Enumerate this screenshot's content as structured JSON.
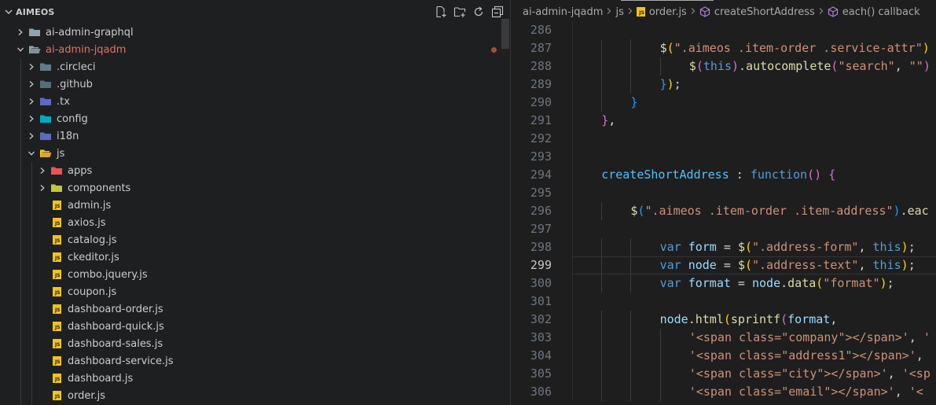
{
  "explorer": {
    "title": "AIMEOS",
    "actions": [
      "new-file-icon",
      "new-folder-icon",
      "refresh-icon",
      "collapse-all-icon"
    ],
    "items": [
      {
        "label": "ai-admin-graphql",
        "depth": 0,
        "type": "folder",
        "expanded": false,
        "icon": "folder-icon",
        "color": "#90a4ae"
      },
      {
        "label": "ai-admin-jqadm",
        "depth": 0,
        "type": "folder",
        "expanded": true,
        "icon": "folder-open-icon",
        "color": "#90a4ae",
        "modified": true
      },
      {
        "label": ".circleci",
        "depth": 1,
        "type": "folder",
        "expanded": false,
        "icon": "folder-circleci-icon",
        "color": "#607d8b"
      },
      {
        "label": ".github",
        "depth": 1,
        "type": "folder",
        "expanded": false,
        "icon": "folder-github-icon",
        "color": "#546e7a"
      },
      {
        "label": ".tx",
        "depth": 1,
        "type": "folder",
        "expanded": false,
        "icon": "folder-i18n-icon",
        "color": "#5c6bc0"
      },
      {
        "label": "config",
        "depth": 1,
        "type": "folder",
        "expanded": false,
        "icon": "folder-config-icon",
        "color": "#00acc1"
      },
      {
        "label": "i18n",
        "depth": 1,
        "type": "folder",
        "expanded": false,
        "icon": "folder-i18n-icon",
        "color": "#5c6bc0"
      },
      {
        "label": "js",
        "depth": 1,
        "type": "folder",
        "expanded": true,
        "icon": "folder-js-open-icon",
        "color": "#fbc02d"
      },
      {
        "label": "apps",
        "depth": 2,
        "type": "folder",
        "expanded": false,
        "icon": "folder-apps-icon",
        "color": "#ef5350"
      },
      {
        "label": "components",
        "depth": 2,
        "type": "folder",
        "expanded": false,
        "icon": "folder-components-icon",
        "color": "#c0ca33"
      },
      {
        "label": "admin.js",
        "depth": 2,
        "type": "file",
        "icon": "js-file-icon"
      },
      {
        "label": "axios.js",
        "depth": 2,
        "type": "file",
        "icon": "js-file-icon"
      },
      {
        "label": "catalog.js",
        "depth": 2,
        "type": "file",
        "icon": "js-file-icon"
      },
      {
        "label": "ckeditor.js",
        "depth": 2,
        "type": "file",
        "icon": "js-file-icon"
      },
      {
        "label": "combo.jquery.js",
        "depth": 2,
        "type": "file",
        "icon": "js-file-icon"
      },
      {
        "label": "coupon.js",
        "depth": 2,
        "type": "file",
        "icon": "js-file-icon"
      },
      {
        "label": "dashboard-order.js",
        "depth": 2,
        "type": "file",
        "icon": "js-file-icon"
      },
      {
        "label": "dashboard-quick.js",
        "depth": 2,
        "type": "file",
        "icon": "js-file-icon"
      },
      {
        "label": "dashboard-sales.js",
        "depth": 2,
        "type": "file",
        "icon": "js-file-icon"
      },
      {
        "label": "dashboard-service.js",
        "depth": 2,
        "type": "file",
        "icon": "js-file-icon"
      },
      {
        "label": "dashboard.js",
        "depth": 2,
        "type": "file",
        "icon": "js-file-icon"
      },
      {
        "label": "order.js",
        "depth": 2,
        "type": "file",
        "icon": "js-file-icon"
      }
    ]
  },
  "breadcrumb": [
    {
      "label": "ai-admin-jqadm",
      "icon": ""
    },
    {
      "label": "js",
      "icon": ""
    },
    {
      "label": "order.js",
      "icon": "js-file-icon"
    },
    {
      "label": "createShortAddress",
      "icon": "method-icon"
    },
    {
      "label": "each() callback",
      "icon": "method-icon"
    }
  ],
  "editor": {
    "current_line": "299",
    "lines": [
      {
        "n": "286",
        "indent": 0,
        "tokens": []
      },
      {
        "n": "287",
        "indent": 3,
        "tokens": [
          [
            "t-fn",
            "$"
          ],
          [
            "t-p1",
            "("
          ],
          [
            "t-str",
            "\".aimeos .item-order .service-attr\""
          ],
          [
            "t-p1",
            ")"
          ]
        ]
      },
      {
        "n": "288",
        "indent": 4,
        "tokens": [
          [
            "t-fn",
            "$"
          ],
          [
            "t-p2",
            "("
          ],
          [
            "t-kw",
            "this"
          ],
          [
            "t-p2",
            ")"
          ],
          [
            "t-def",
            "."
          ],
          [
            "t-fn",
            "autocomplete"
          ],
          [
            "t-p2",
            "("
          ],
          [
            "t-str",
            "\"search\""
          ],
          [
            "t-def",
            ", "
          ],
          [
            "t-str",
            "\"\""
          ],
          [
            "t-p2",
            ")"
          ]
        ]
      },
      {
        "n": "289",
        "indent": 3,
        "tokens": [
          [
            "t-p3",
            "}"
          ],
          [
            "t-p1",
            ")"
          ],
          [
            "t-def",
            ";"
          ]
        ]
      },
      {
        "n": "290",
        "indent": 2,
        "tokens": [
          [
            "t-p3",
            "}"
          ]
        ]
      },
      {
        "n": "291",
        "indent": 1,
        "tokens": [
          [
            "t-p2",
            "}"
          ],
          [
            "t-def",
            ","
          ]
        ]
      },
      {
        "n": "292",
        "indent": 0,
        "tokens": []
      },
      {
        "n": "293",
        "indent": 0,
        "tokens": []
      },
      {
        "n": "294",
        "indent": 1,
        "tokens": [
          [
            "t-prop",
            "createShortAddress"
          ],
          [
            "t-def",
            " : "
          ],
          [
            "t-kw",
            "function"
          ],
          [
            "t-p2",
            "()"
          ],
          [
            "t-def",
            " "
          ],
          [
            "t-p2",
            "{"
          ]
        ]
      },
      {
        "n": "295",
        "indent": 0,
        "tokens": []
      },
      {
        "n": "296",
        "indent": 2,
        "tokens": [
          [
            "t-fn",
            "$"
          ],
          [
            "t-p3",
            "("
          ],
          [
            "t-str",
            "\".aimeos .item-order .item-address\""
          ],
          [
            "t-p3",
            ")"
          ],
          [
            "t-def",
            "."
          ],
          [
            "t-fn",
            "eac"
          ]
        ]
      },
      {
        "n": "297",
        "indent": 0,
        "tokens": []
      },
      {
        "n": "298",
        "indent": 3,
        "tokens": [
          [
            "t-kw",
            "var"
          ],
          [
            "t-def",
            " "
          ],
          [
            "t-var",
            "form"
          ],
          [
            "t-def",
            " = "
          ],
          [
            "t-fn",
            "$"
          ],
          [
            "t-p1",
            "("
          ],
          [
            "t-str",
            "\".address-form\""
          ],
          [
            "t-def",
            ", "
          ],
          [
            "t-kw",
            "this"
          ],
          [
            "t-p1",
            ")"
          ],
          [
            "t-def",
            ";"
          ]
        ]
      },
      {
        "n": "299",
        "indent": 3,
        "tokens": [
          [
            "t-kw",
            "var"
          ],
          [
            "t-def",
            " "
          ],
          [
            "t-var",
            "node"
          ],
          [
            "t-def",
            " = "
          ],
          [
            "t-fn",
            "$"
          ],
          [
            "t-p1",
            "("
          ],
          [
            "t-str",
            "\".address-text\""
          ],
          [
            "t-def",
            ", "
          ],
          [
            "t-kw",
            "this"
          ],
          [
            "t-p1",
            ")"
          ],
          [
            "t-def",
            ";"
          ]
        ]
      },
      {
        "n": "300",
        "indent": 3,
        "tokens": [
          [
            "t-kw",
            "var"
          ],
          [
            "t-def",
            " "
          ],
          [
            "t-var",
            "format"
          ],
          [
            "t-def",
            " = "
          ],
          [
            "t-var",
            "node"
          ],
          [
            "t-def",
            "."
          ],
          [
            "t-fn",
            "data"
          ],
          [
            "t-p1",
            "("
          ],
          [
            "t-str",
            "\"format\""
          ],
          [
            "t-p1",
            ")"
          ],
          [
            "t-def",
            ";"
          ]
        ]
      },
      {
        "n": "301",
        "indent": 0,
        "tokens": []
      },
      {
        "n": "302",
        "indent": 3,
        "tokens": [
          [
            "t-var",
            "node"
          ],
          [
            "t-def",
            "."
          ],
          [
            "t-fn",
            "html"
          ],
          [
            "t-p1",
            "("
          ],
          [
            "t-fn",
            "sprintf"
          ],
          [
            "t-p2",
            "("
          ],
          [
            "t-var",
            "format"
          ],
          [
            "t-def",
            ","
          ]
        ]
      },
      {
        "n": "303",
        "indent": 4,
        "tokens": [
          [
            "t-str",
            "'<span class=\"company\"></span>'"
          ],
          [
            "t-def",
            ", "
          ],
          [
            "t-str",
            "'"
          ]
        ]
      },
      {
        "n": "304",
        "indent": 4,
        "tokens": [
          [
            "t-str",
            "'<span class=\"address1\"></span>'"
          ],
          [
            "t-def",
            ","
          ]
        ]
      },
      {
        "n": "305",
        "indent": 4,
        "tokens": [
          [
            "t-str",
            "'<span class=\"city\"></span>'"
          ],
          [
            "t-def",
            ", "
          ],
          [
            "t-str",
            "'<sp"
          ]
        ]
      },
      {
        "n": "306",
        "indent": 4,
        "tokens": [
          [
            "t-str",
            "'<span class=\"email\"></span>'"
          ],
          [
            "t-def",
            ", "
          ],
          [
            "t-str",
            "'<"
          ]
        ]
      }
    ]
  }
}
